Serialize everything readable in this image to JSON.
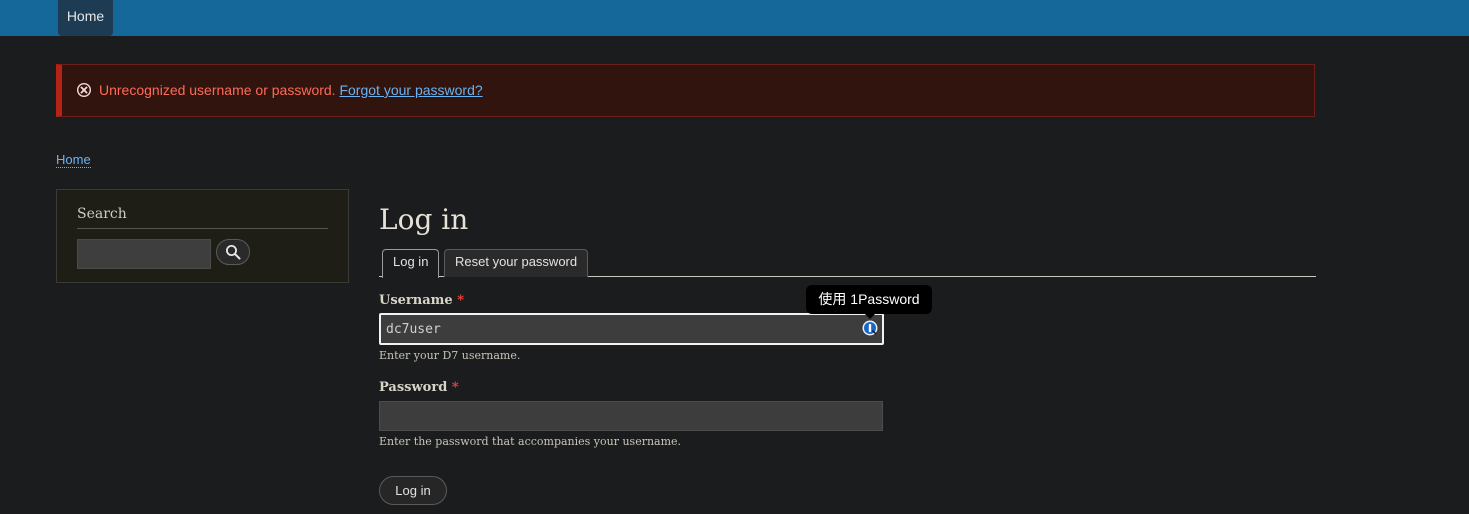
{
  "topbar": {
    "home_tab": "Home"
  },
  "error": {
    "message": "Unrecognized username or password.",
    "link": "Forgot your password?"
  },
  "breadcrumb": {
    "home": "Home"
  },
  "search": {
    "title": "Search",
    "value": "",
    "button_icon": "search-icon"
  },
  "page": {
    "title": "Log in"
  },
  "tabs": [
    {
      "label": "Log in",
      "active": true
    },
    {
      "label": "Reset your password",
      "active": false
    }
  ],
  "form": {
    "username": {
      "label": "Username",
      "required_mark": "*",
      "value": "dc7user",
      "description": "Enter your D7 username."
    },
    "password": {
      "label": "Password",
      "required_mark": "*",
      "value": "",
      "description": "Enter the password that accompanies your username."
    },
    "submit_label": "Log in"
  },
  "onepassword": {
    "tooltip": "使用 1Password",
    "icon": "1password-icon"
  },
  "colors": {
    "topbar": "#14689a",
    "error_border": "#b52216",
    "error_text": "#ff6a57",
    "link": "#69b3f2"
  }
}
